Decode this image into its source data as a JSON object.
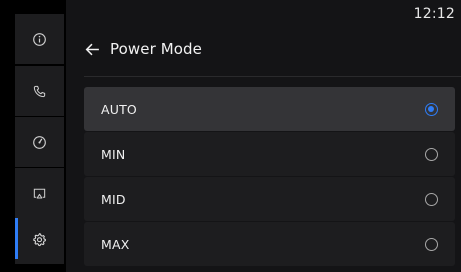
{
  "status_bar": {
    "time": "12:12"
  },
  "sidebar": {
    "items": [
      {
        "icon": "info-icon",
        "selected": false
      },
      {
        "icon": "phone-icon",
        "selected": false
      },
      {
        "icon": "gauge-icon",
        "selected": false
      },
      {
        "icon": "screen-mirror-icon",
        "selected": false
      },
      {
        "icon": "gear-icon",
        "selected": true
      }
    ],
    "accent_color": "#2f7df6"
  },
  "header": {
    "title": "Power Mode"
  },
  "options": [
    {
      "label": "AUTO",
      "selected": true
    },
    {
      "label": "MIN",
      "selected": false
    },
    {
      "label": "MID",
      "selected": false
    },
    {
      "label": "MAX",
      "selected": false
    }
  ]
}
